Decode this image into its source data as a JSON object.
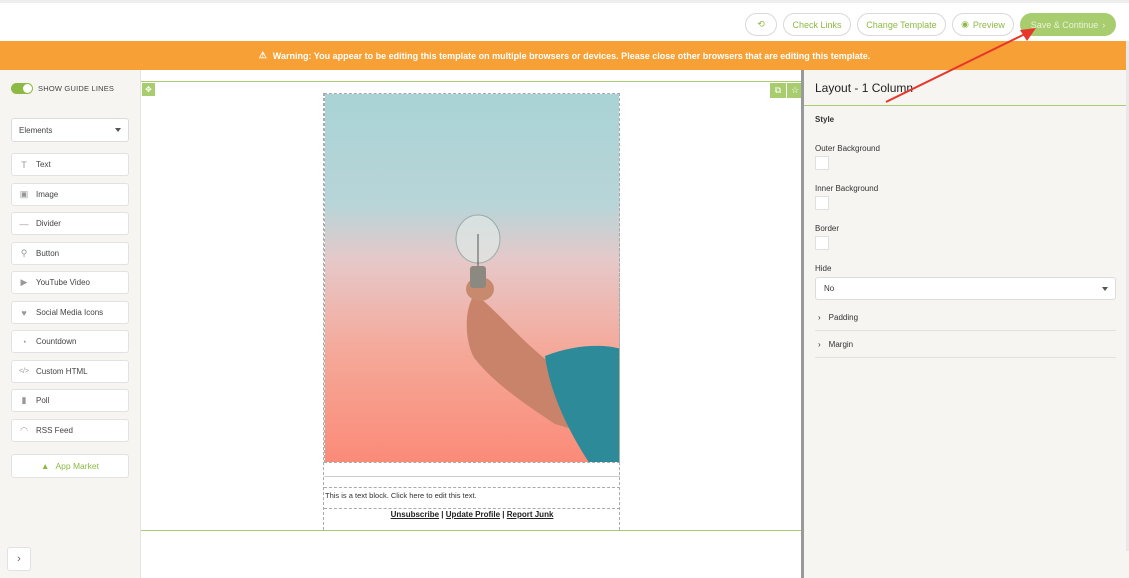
{
  "toolbar": {
    "check_links": "Check Links",
    "change_template": "Change Template",
    "preview": "Preview",
    "save_continue": "Save & Continue"
  },
  "warning": {
    "text": "Warning: You appear to be editing this template on multiple browsers or devices. Please close other browsers that are editing this template."
  },
  "left": {
    "guide_toggle_label": "SHOW GUIDE LINES",
    "elements_select": "Elements",
    "items": [
      {
        "label": "Text",
        "icon": "text-icon"
      },
      {
        "label": "Image",
        "icon": "image-icon"
      },
      {
        "label": "Divider",
        "icon": "divider-icon"
      },
      {
        "label": "Button",
        "icon": "button-icon"
      },
      {
        "label": "YouTube Video",
        "icon": "youtube-icon"
      },
      {
        "label": "Social Media Icons",
        "icon": "heart-icon"
      },
      {
        "label": "Countdown",
        "icon": "clock-icon"
      },
      {
        "label": "Custom HTML",
        "icon": "code-icon"
      },
      {
        "label": "Poll",
        "icon": "poll-icon"
      },
      {
        "label": "RSS Feed",
        "icon": "rss-icon"
      }
    ],
    "app_market": "App Market"
  },
  "canvas": {
    "text_block": "This is a text block. Click here to edit this text.",
    "links": [
      "Unsubscribe",
      "Update Profile",
      "Report Junk"
    ],
    "link_separator": "|"
  },
  "right": {
    "title": "Layout - 1 Column",
    "style_label": "Style",
    "outer_bg_label": "Outer Background",
    "inner_bg_label": "Inner Background",
    "border_label": "Border",
    "hide_label": "Hide",
    "hide_value": "No",
    "padding_label": "Padding",
    "margin_label": "Margin"
  },
  "colors": {
    "accent": "#8dba45",
    "warning": "#f7a035",
    "arrow": "#e8372a"
  }
}
